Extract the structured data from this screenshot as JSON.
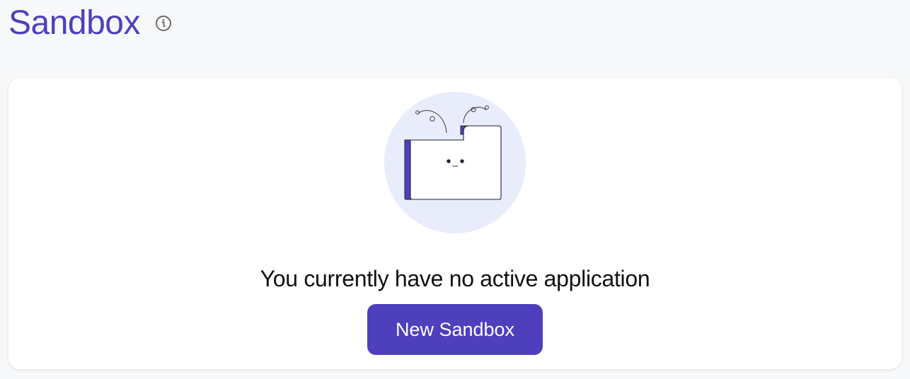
{
  "header": {
    "title": "Sandbox",
    "info_icon": "info-icon"
  },
  "empty_state": {
    "illustration_icon": "folder-icon",
    "message": "You currently have no active application",
    "button_label": "New Sandbox"
  },
  "colors": {
    "accent": "#4e3fbd",
    "page_background": "#f7f8fa",
    "card_background": "#ffffff",
    "illustration_circle": "#e8ecfb"
  }
}
